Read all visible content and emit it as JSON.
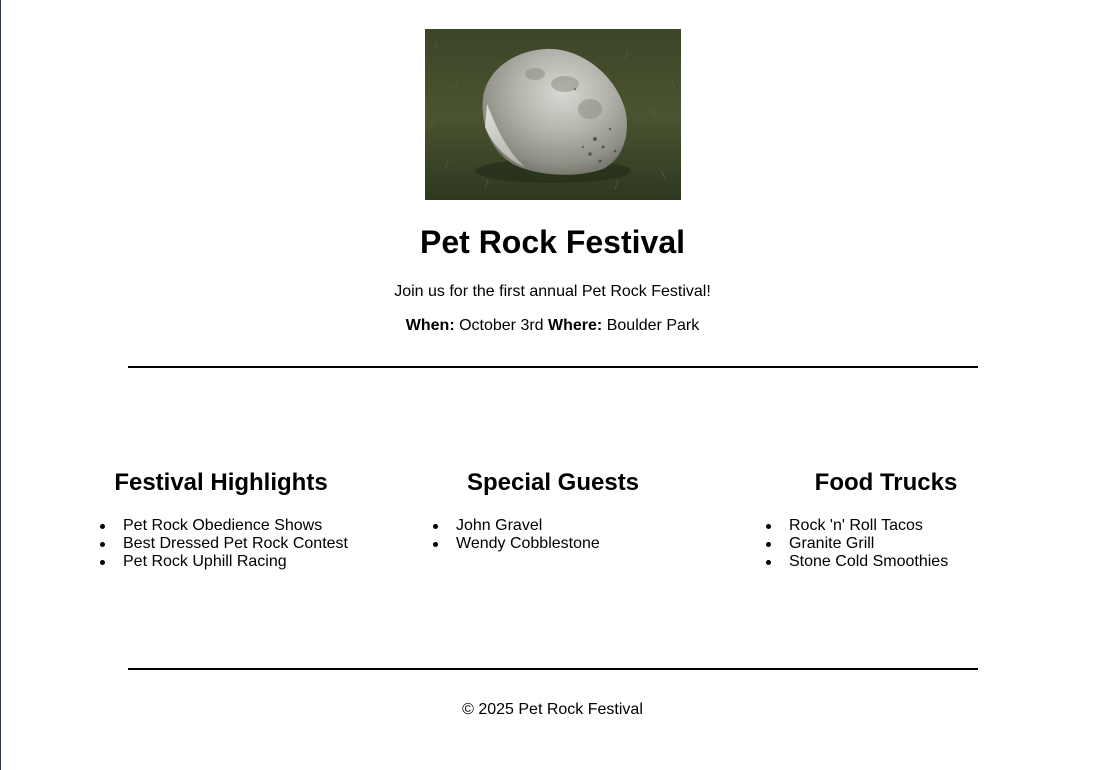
{
  "header": {
    "image_alt": "pet rock photo",
    "title": "Pet Rock Festival",
    "intro": "Join us for the first annual Pet Rock Festival!",
    "when_label": "When:",
    "when_value": "October 3rd",
    "where_label": "Where:",
    "where_value": "Boulder Park"
  },
  "sections": [
    {
      "heading": "Festival Highlights",
      "items": [
        "Pet Rock Obedience Shows",
        "Best Dressed Pet Rock Contest",
        "Pet Rock Uphill Racing"
      ]
    },
    {
      "heading": "Special Guests",
      "items": [
        "John Gravel",
        "Wendy Cobblestone"
      ]
    },
    {
      "heading": "Food Trucks",
      "items": [
        "Rock 'n' Roll Tacos",
        "Granite Grill",
        "Stone Cold Smoothies"
      ]
    }
  ],
  "footer": {
    "text": "© 2025 Pet Rock Festival"
  },
  "colors": {
    "grass": "#3e4a2a",
    "rock": "#b8b8b2"
  }
}
